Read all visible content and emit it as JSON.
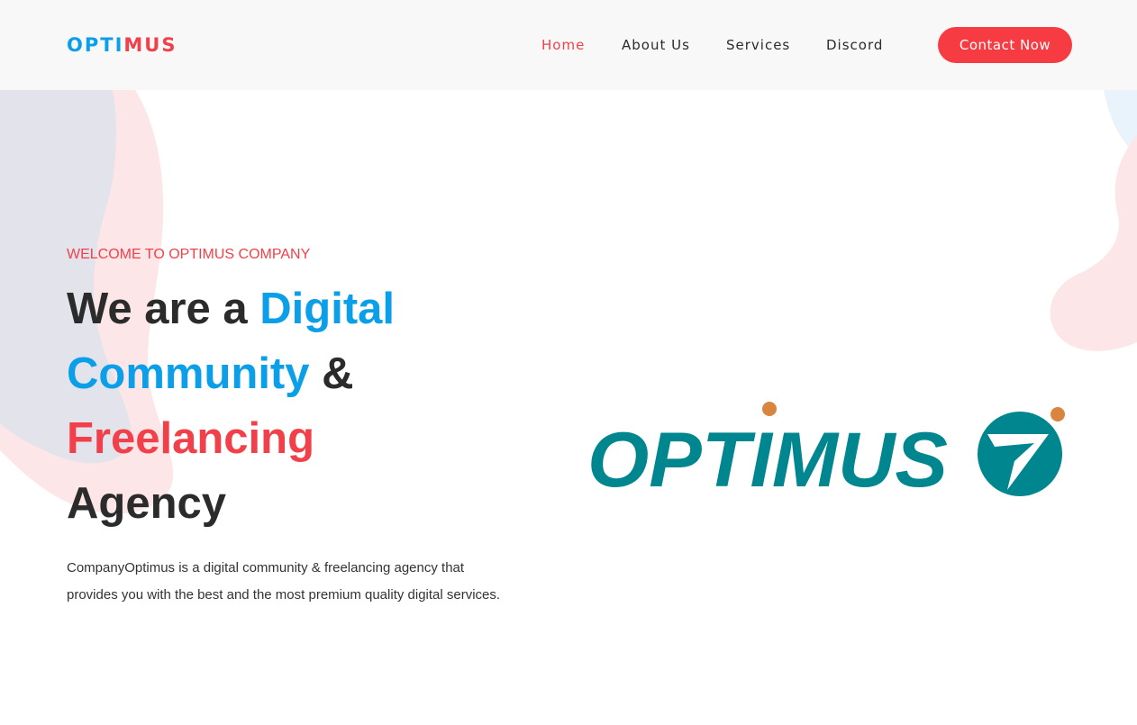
{
  "brand": {
    "part1": "OPTI",
    "part2": "MUS"
  },
  "nav": {
    "items": [
      {
        "label": "Home",
        "active": true
      },
      {
        "label": "About Us",
        "active": false
      },
      {
        "label": "Services",
        "active": false
      },
      {
        "label": "Discord",
        "active": false
      }
    ],
    "cta_label": "Contact Now"
  },
  "hero": {
    "eyebrow": "WELCOME TO OPTIMUS COMPANY",
    "headline": {
      "l1_dark": "We are a ",
      "l1_blue": "Digital",
      "l2_blue": "Community",
      "l2_dark": " &",
      "l3_red": "Freelancing",
      "l4_dark": "Agency"
    },
    "description": "CompanyOptimus is a digital community & freelancing agency that provides you with the best and the most premium quality digital services."
  },
  "logo": {
    "wordmark": "OPTIMUS"
  },
  "colors": {
    "accent_red": "#f2404a",
    "accent_blue": "#0a9fe8",
    "logo_teal": "#00868f",
    "logo_orange": "#d9843f"
  }
}
